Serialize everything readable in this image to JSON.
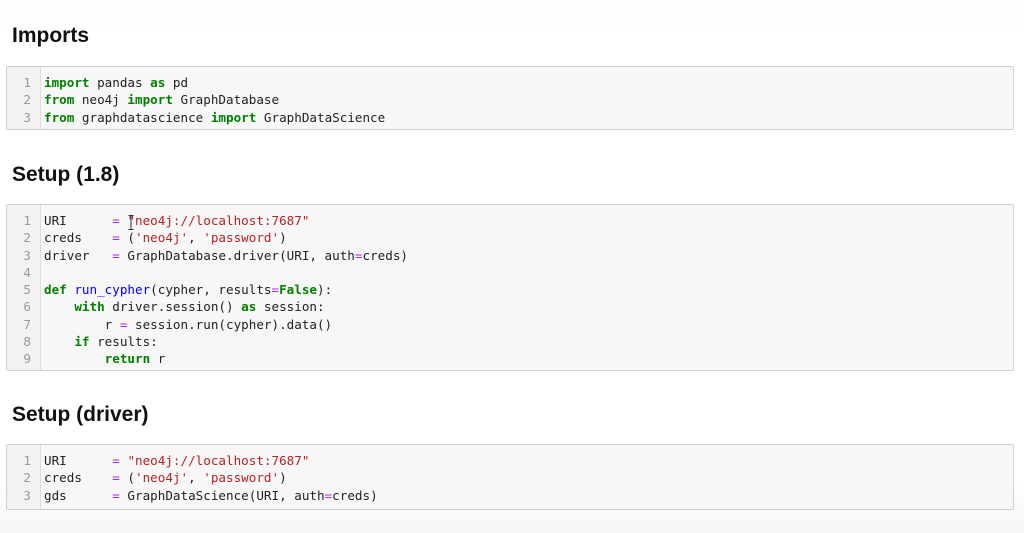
{
  "sections": [
    {
      "id": "imports",
      "heading": "Imports",
      "lines": [
        [
          {
            "t": "import",
            "c": "kw"
          },
          {
            "t": " pandas ",
            "c": "plain"
          },
          {
            "t": "as",
            "c": "kw"
          },
          {
            "t": " pd",
            "c": "plain"
          }
        ],
        [
          {
            "t": "from",
            "c": "kw"
          },
          {
            "t": " neo4j ",
            "c": "plain"
          },
          {
            "t": "import",
            "c": "kw"
          },
          {
            "t": " GraphDatabase",
            "c": "plain"
          }
        ],
        [
          {
            "t": "from",
            "c": "kw"
          },
          {
            "t": " graphdatascience ",
            "c": "plain"
          },
          {
            "t": "import",
            "c": "kw"
          },
          {
            "t": " GraphDataScience",
            "c": "plain"
          }
        ]
      ]
    },
    {
      "id": "setup-1-8",
      "heading": "Setup (1.8)",
      "lines": [
        [
          {
            "t": "URI      ",
            "c": "plain"
          },
          {
            "t": "=",
            "c": "op"
          },
          {
            "t": " ",
            "c": "plain"
          },
          {
            "t": "\"neo4j://localhost:7687\"",
            "c": "str"
          }
        ],
        [
          {
            "t": "creds    ",
            "c": "plain"
          },
          {
            "t": "=",
            "c": "op"
          },
          {
            "t": " (",
            "c": "plain"
          },
          {
            "t": "'neo4j'",
            "c": "str"
          },
          {
            "t": ", ",
            "c": "plain"
          },
          {
            "t": "'password'",
            "c": "str"
          },
          {
            "t": ")",
            "c": "plain"
          }
        ],
        [
          {
            "t": "driver   ",
            "c": "plain"
          },
          {
            "t": "=",
            "c": "op"
          },
          {
            "t": " GraphDatabase.driver(URI, auth",
            "c": "plain"
          },
          {
            "t": "=",
            "c": "op"
          },
          {
            "t": "creds)",
            "c": "plain"
          }
        ],
        [
          {
            "t": "",
            "c": "plain"
          }
        ],
        [
          {
            "t": "def",
            "c": "kw"
          },
          {
            "t": " ",
            "c": "plain"
          },
          {
            "t": "run_cypher",
            "c": "fn"
          },
          {
            "t": "(cypher, results",
            "c": "plain"
          },
          {
            "t": "=",
            "c": "op"
          },
          {
            "t": "False",
            "c": "kw"
          },
          {
            "t": "):",
            "c": "plain"
          }
        ],
        [
          {
            "t": "    ",
            "c": "plain"
          },
          {
            "t": "with",
            "c": "kw"
          },
          {
            "t": " driver.session() ",
            "c": "plain"
          },
          {
            "t": "as",
            "c": "kw"
          },
          {
            "t": " session:",
            "c": "plain"
          }
        ],
        [
          {
            "t": "        r ",
            "c": "plain"
          },
          {
            "t": "=",
            "c": "op"
          },
          {
            "t": " session.run(cypher).data()",
            "c": "plain"
          }
        ],
        [
          {
            "t": "    ",
            "c": "plain"
          },
          {
            "t": "if",
            "c": "kw"
          },
          {
            "t": " results:",
            "c": "plain"
          }
        ],
        [
          {
            "t": "        ",
            "c": "plain"
          },
          {
            "t": "return",
            "c": "kw"
          },
          {
            "t": " r",
            "c": "plain"
          }
        ]
      ]
    },
    {
      "id": "setup-driver",
      "heading": "Setup (driver)",
      "lines": [
        [
          {
            "t": "URI      ",
            "c": "plain"
          },
          {
            "t": "=",
            "c": "op"
          },
          {
            "t": " ",
            "c": "plain"
          },
          {
            "t": "\"neo4j://localhost:7687\"",
            "c": "str"
          }
        ],
        [
          {
            "t": "creds    ",
            "c": "plain"
          },
          {
            "t": "=",
            "c": "op"
          },
          {
            "t": " (",
            "c": "plain"
          },
          {
            "t": "'neo4j'",
            "c": "str"
          },
          {
            "t": ", ",
            "c": "plain"
          },
          {
            "t": "'password'",
            "c": "str"
          },
          {
            "t": ")",
            "c": "plain"
          }
        ],
        [
          {
            "t": "gds      ",
            "c": "plain"
          },
          {
            "t": "=",
            "c": "op"
          },
          {
            "t": " GraphDataScience(URI, auth",
            "c": "plain"
          },
          {
            "t": "=",
            "c": "op"
          },
          {
            "t": "creds)",
            "c": "plain"
          }
        ]
      ]
    }
  ],
  "icons": {
    "cursor": "text-cursor-icon"
  },
  "colors": {
    "keyword": "#008000",
    "string": "#ba2121",
    "operator": "#aa22ff",
    "function": "#0000ff"
  }
}
